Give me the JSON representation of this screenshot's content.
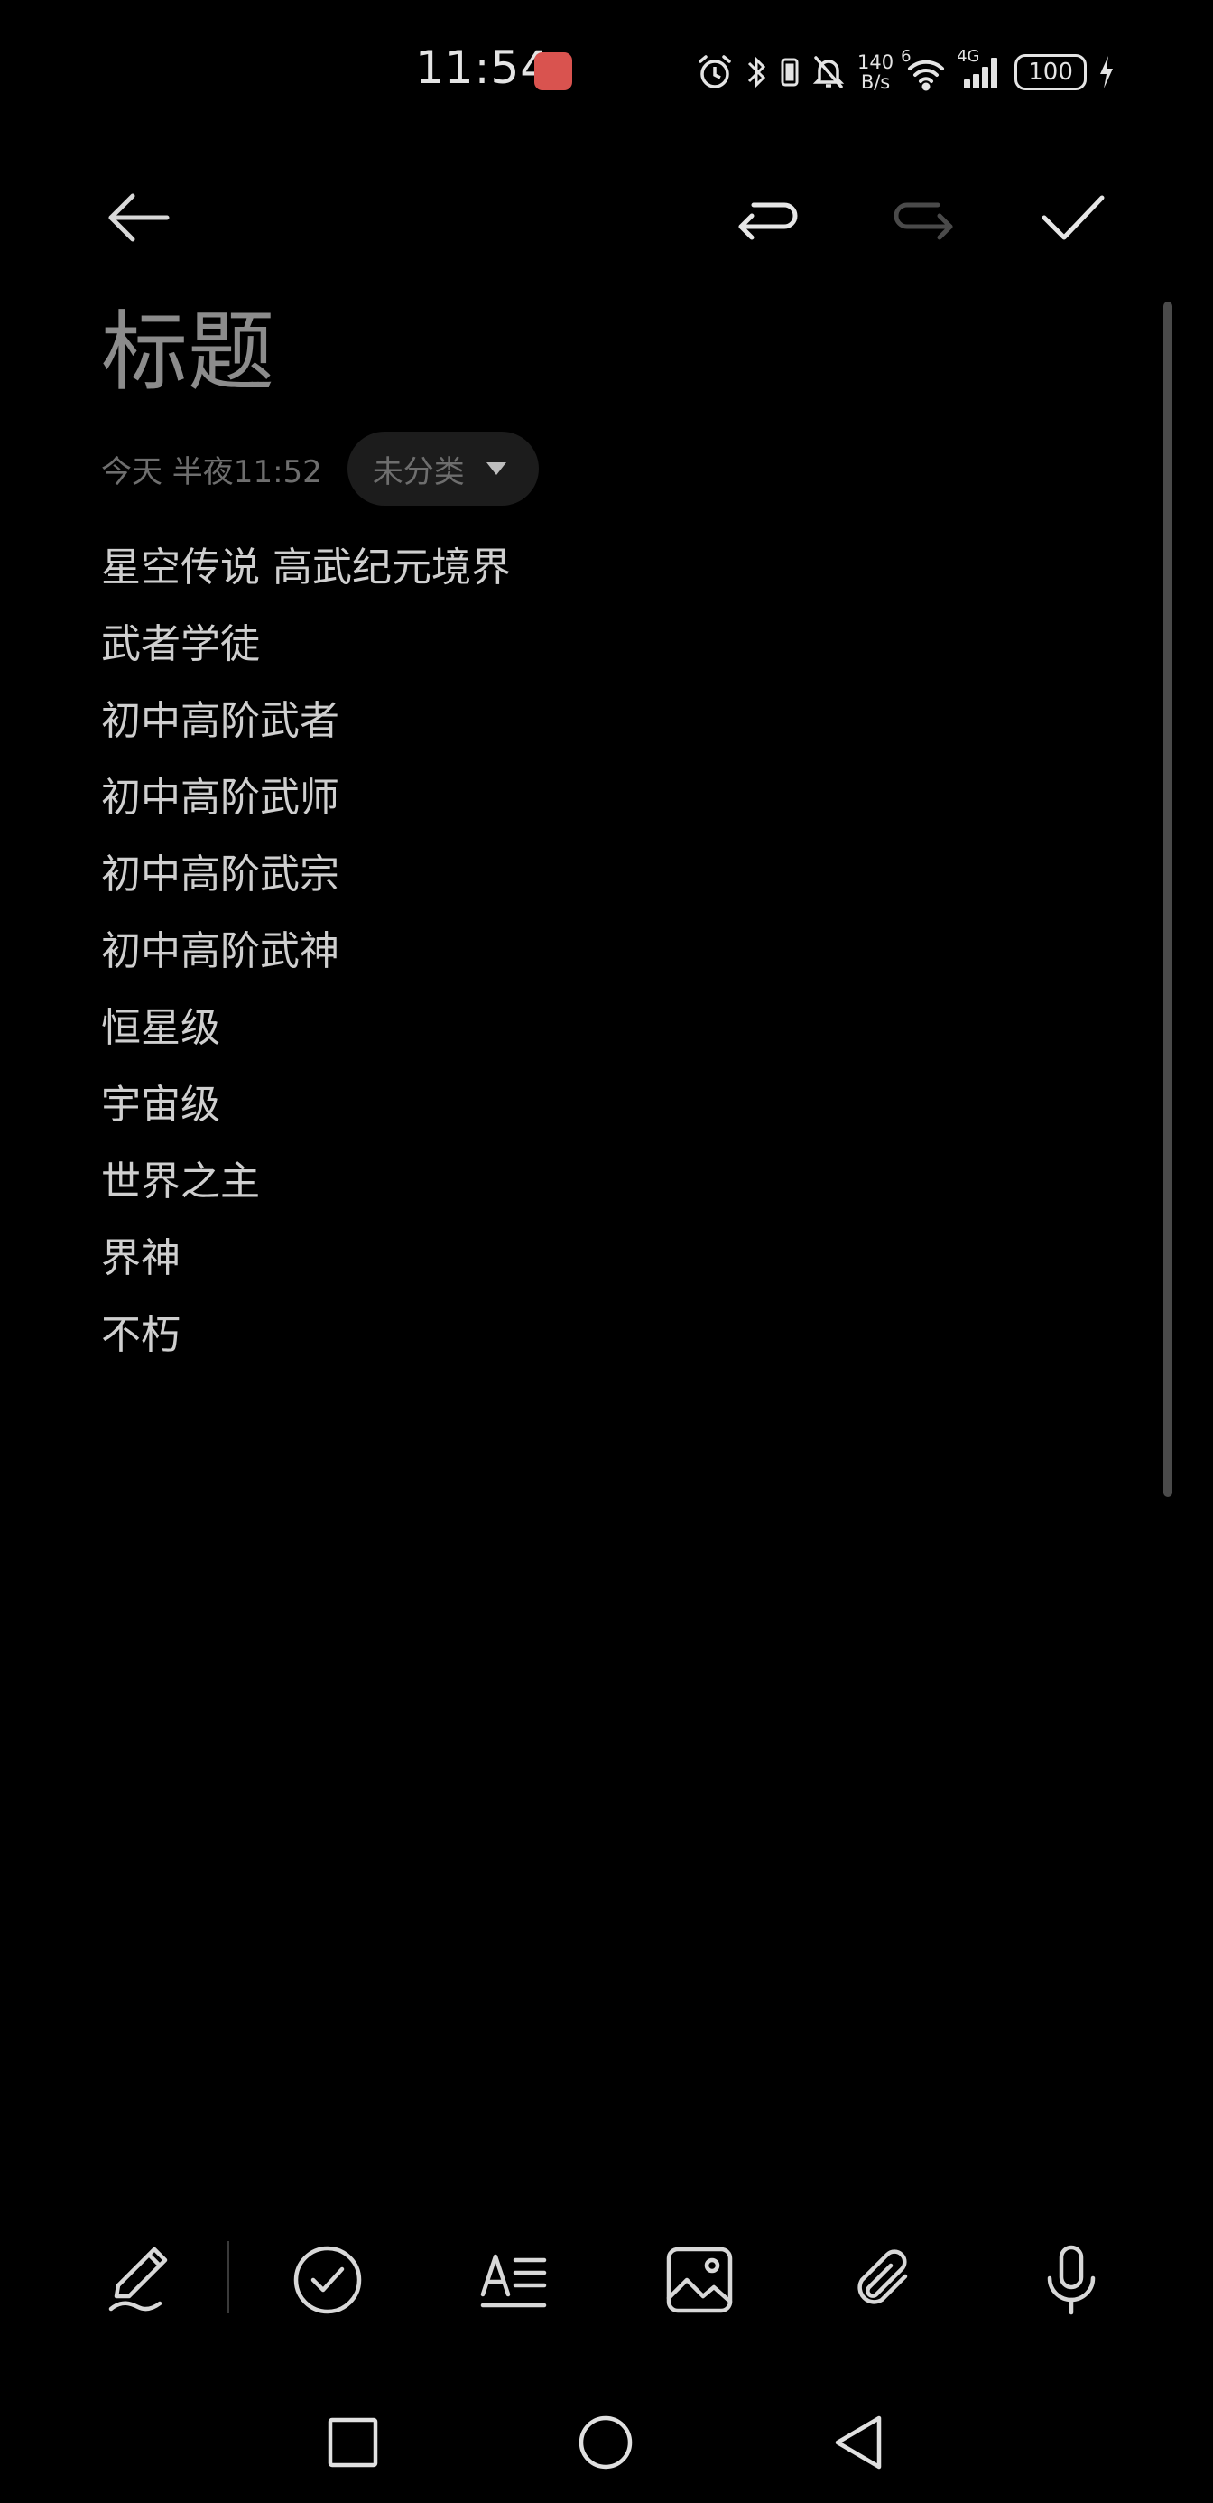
{
  "status_bar": {
    "time": "11:54",
    "net_speed_value": "140",
    "net_speed_unit": "B/s",
    "wifi_label": "6",
    "mobile_label": "4G",
    "battery_level": "100",
    "icons": [
      "alarm-icon",
      "bluetooth-icon",
      "vibrate-icon",
      "mute-icon",
      "wifi-icon",
      "cellular-signal-icon",
      "battery-icon",
      "charging-icon"
    ]
  },
  "toolbar": {
    "icons": [
      "back-arrow-icon",
      "undo-icon",
      "redo-icon",
      "check-icon"
    ]
  },
  "note": {
    "title": "标题",
    "timestamp": "今天 半夜11:52",
    "category": "未分类",
    "lines": [
      "星空传说 高武纪元境界",
      "武者学徒",
      "初中高阶武者",
      "初中高阶武师",
      "初中高阶武宗",
      "初中高阶武神",
      "恒星级",
      "宇宙级",
      "世界之主",
      "界神",
      "不朽"
    ]
  },
  "bottom_toolbar": {
    "icons": [
      "handwriting-pen-icon",
      "checklist-icon",
      "text-format-icon",
      "image-icon",
      "attachment-icon",
      "microphone-icon"
    ]
  },
  "nav_bar": {
    "icons": [
      "recent-apps-square-icon",
      "home-circle-icon",
      "back-triangle-icon"
    ]
  },
  "colors": {
    "background": "#000000",
    "text": "#cfcfcf",
    "muted": "#6e6e6e",
    "chip": "#1c1c1c",
    "app_badge": "#d9534f"
  }
}
